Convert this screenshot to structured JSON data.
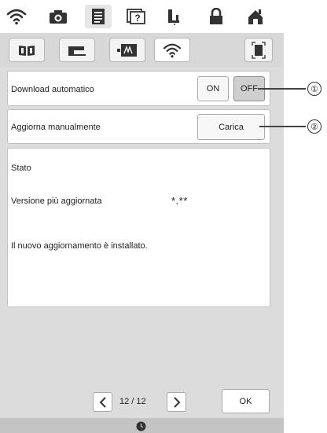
{
  "top_tabs": [
    {
      "icon": "wifi-icon"
    },
    {
      "icon": "camera-icon"
    },
    {
      "icon": "document-icon",
      "active": true
    },
    {
      "icon": "help-icon"
    },
    {
      "icon": "needle-icon"
    },
    {
      "icon": "lock-icon"
    },
    {
      "icon": "home-icon"
    }
  ],
  "sub_tabs": [
    {
      "icon": "book-icon"
    },
    {
      "icon": "machine-icon"
    },
    {
      "icon": "embroidery-card-icon"
    },
    {
      "icon": "wifi-icon",
      "active": true
    }
  ],
  "download": {
    "label": "Download automatico",
    "on_label": "ON",
    "off_label": "OFF",
    "selected": "OFF"
  },
  "manual_update": {
    "label": "Aggiorna manualmente",
    "button_label": "Carica"
  },
  "status": {
    "title": "Stato",
    "latest_version_label": "Versione più aggiornata",
    "latest_version_value": "*.**",
    "message": "Il nuovo aggiornamento è installato."
  },
  "pager": {
    "text": "12 / 12"
  },
  "ok_label": "OK",
  "callouts": [
    "①",
    "②"
  ]
}
